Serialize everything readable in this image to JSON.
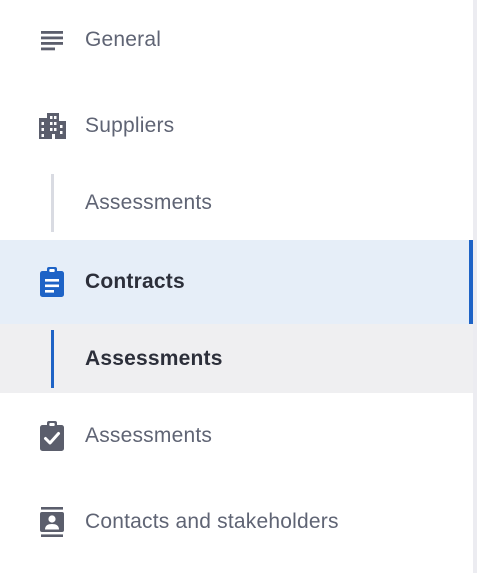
{
  "nav": {
    "general": {
      "label": "General",
      "icon": "lines-icon"
    },
    "suppliers": {
      "label": "Suppliers",
      "icon": "building-icon"
    },
    "suppliers_sub": {
      "label": "Assessments"
    },
    "contracts": {
      "label": "Contracts",
      "icon": "clipboard-icon",
      "state": "active"
    },
    "contracts_sub": {
      "label": "Assessments",
      "state": "selected"
    },
    "assessments": {
      "label": "Assessments",
      "icon": "clipboard-check-icon"
    },
    "contacts": {
      "label": "Contacts and stakeholders",
      "icon": "contact-card-icon"
    }
  },
  "colors": {
    "accent": "#1e63c6",
    "active_bg": "#e6eef8",
    "selected_bg": "#efeff1",
    "text": "#5f6474",
    "text_strong": "#2c2f3a",
    "icon": "#5b5e6c"
  }
}
